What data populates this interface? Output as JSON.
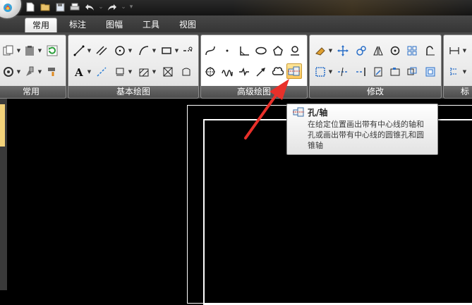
{
  "quick_access": {
    "icons": [
      "new-file-icon",
      "open-folder-icon",
      "save-icon",
      "print-icon",
      "undo-icon",
      "redo-icon",
      "customize-icon"
    ]
  },
  "tabs": [
    {
      "label": "常用",
      "active": true
    },
    {
      "label": "标注",
      "active": false
    },
    {
      "label": "图幅",
      "active": false
    },
    {
      "label": "工具",
      "active": false
    },
    {
      "label": "视图",
      "active": false
    }
  ],
  "ribbon": {
    "groups": [
      {
        "label": "常用"
      },
      {
        "label": "基本绘图"
      },
      {
        "label": "高级绘图"
      },
      {
        "label": "修改"
      },
      {
        "label": "标"
      }
    ]
  },
  "tooltip": {
    "title": "孔/轴",
    "lines": [
      "在给定位置画出带有中心线的轴和",
      "孔或画出带有中心线的圆锥孔和圆",
      "锥轴"
    ]
  },
  "colors": {
    "accent_arrow": "#e8302a",
    "hover_tool": "#ffc55a",
    "canvas": "#000000"
  }
}
